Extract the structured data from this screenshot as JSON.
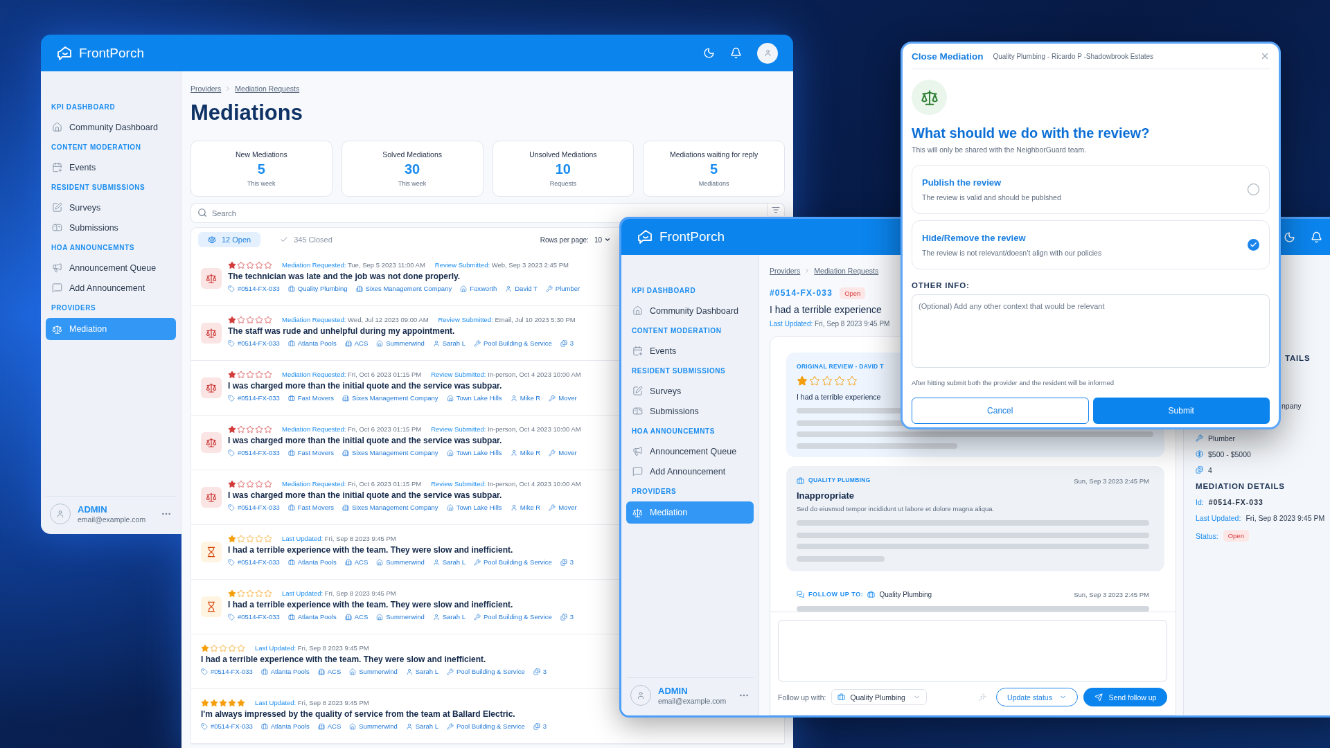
{
  "main_window": {
    "brand": "**Front**Porch",
    "sidebar": {
      "sections": [
        {
          "title": "KPI DASHBOARD",
          "items": [
            {
              "label": "Community Dashboard",
              "selected": false
            }
          ]
        },
        {
          "title": "CONTENT MODERATION",
          "items": [
            {
              "label": "Events",
              "selected": false
            }
          ]
        },
        {
          "title": "RESIDENT SUBMISSIONS",
          "items": [
            {
              "label": "Surveys",
              "selected": false
            },
            {
              "label": "Submissions",
              "selected": false
            }
          ]
        },
        {
          "title": "HOA ANNOUNCEMNTS",
          "items": [
            {
              "label": "Announcement Queue",
              "selected": false
            },
            {
              "label": "Add Announcement",
              "selected": false
            }
          ]
        },
        {
          "title": "PROVIDERS",
          "items": [
            {
              "label": "Mediation",
              "selected": true
            }
          ]
        }
      ],
      "user": {
        "name": "ADMIN",
        "email": "email@example.com"
      }
    },
    "breadcrumbs": [
      "Providers",
      "Mediation Requests"
    ],
    "title": "Mediations",
    "stats": [
      {
        "label": "New Mediations",
        "value": "5",
        "caption": "This week"
      },
      {
        "label": "Solved Mediations",
        "value": "30",
        "caption": "This week"
      },
      {
        "label": "Unsolved Mediations",
        "value": "10",
        "caption": "Requests"
      },
      {
        "label": "Mediations waiting for reply",
        "value": "5",
        "caption": "Mediations"
      }
    ],
    "search": {
      "placeholder": "Search"
    },
    "tabs": [
      {
        "label": "12 Open",
        "selected": true
      },
      {
        "label": "345 Closed",
        "selected": false
      }
    ],
    "rows_per_page": {
      "label": "Rows per page:",
      "value": "10"
    },
    "rows": [
      {
        "kind": "mediation",
        "stars": 1,
        "fields": [
          {
            "label": "Mediation Requested:",
            "value": "Tue, Sep 5 2023 11:00 AM"
          },
          {
            "label": "Review Submitted:",
            "value": "Web, Sep 3 2023 2:45 PM"
          }
        ],
        "text": "The technician was late and the job was not done properly.",
        "meta": [
          "#0514-FX-033",
          "Quality Plumbing",
          "Sixes Management Company",
          "Foxworth",
          "David T",
          "Plumber"
        ]
      },
      {
        "kind": "mediation",
        "stars": 1,
        "fields": [
          {
            "label": "Mediation Requested:",
            "value": "Wed, Jul 12 2023 09:00 AM"
          },
          {
            "label": "Review Submitted:",
            "value": "Email, Jul 10 2023 5:30 PM"
          }
        ],
        "text": "The staff was rude and unhelpful during my appointment.",
        "meta": [
          "#0514-FX-033",
          "Atlanta Pools",
          "ACS",
          "Summerwind",
          "Sarah L",
          "Pool Building & Service",
          "3"
        ]
      },
      {
        "kind": "mediation",
        "stars": 1,
        "fields": [
          {
            "label": "Mediation Requested:",
            "value": "Fri, Oct 6 2023 01:15 PM"
          },
          {
            "label": "Review Submitted:",
            "value": "In-person, Oct 4 2023 10:00 AM"
          }
        ],
        "text": "I was charged more than the initial quote and the service was subpar.",
        "meta": [
          "#0514-FX-033",
          "Fast Movers",
          "Sixes Management Company",
          "Town Lake Hills",
          "Mike R",
          "Mover"
        ]
      },
      {
        "kind": "mediation",
        "stars": 1,
        "fields": [
          {
            "label": "Mediation Requested:",
            "value": "Fri, Oct 6 2023 01:15 PM"
          },
          {
            "label": "Review Submitted:",
            "value": "In-person, Oct 4 2023 10:00 AM"
          }
        ],
        "text": "I was charged more than the initial quote and the service was subpar.",
        "meta": [
          "#0514-FX-033",
          "Fast Movers",
          "Sixes Management Company",
          "Town Lake Hills",
          "Mike R",
          "Mover"
        ]
      },
      {
        "kind": "mediation",
        "stars": 1,
        "fields": [
          {
            "label": "Mediation Requested:",
            "value": "Fri, Oct 6 2023 01:15 PM"
          },
          {
            "label": "Review Submitted:",
            "value": "In-person, Oct 4 2023 10:00 AM"
          }
        ],
        "text": "I was charged more than the initial quote and the service was subpar.",
        "meta": [
          "#0514-FX-033",
          "Fast Movers",
          "Sixes Management Company",
          "Town Lake Hills",
          "Mike R",
          "Mover"
        ]
      },
      {
        "kind": "pending",
        "stars": 1,
        "fields": [
          {
            "label": "Last Updated:",
            "value": "Fri, Sep 8 2023 9:45 PM"
          }
        ],
        "text": "I had a terrible experience with the team. They were slow and inefficient.",
        "meta": [
          "#0514-FX-033",
          "Atlanta Pools",
          "ACS",
          "Summerwind",
          "Sarah L",
          "Pool Building & Service",
          "3"
        ]
      },
      {
        "kind": "pending",
        "stars": 1,
        "fields": [
          {
            "label": "Last Updated:",
            "value": "Fri, Sep 8 2023 9:45 PM"
          }
        ],
        "text": "I had a terrible experience with the team. They were slow and inefficient.",
        "meta": [
          "#0514-FX-033",
          "Atlanta Pools",
          "ACS",
          "Summerwind",
          "Sarah L",
          "Pool Building & Service",
          "3"
        ]
      },
      {
        "kind": "plain",
        "stars": 1,
        "fields": [
          {
            "label": "Last Updated:",
            "value": "Fri, Sep 8 2023 9:45 PM"
          }
        ],
        "text": "I had a terrible experience with the team. They were slow and inefficient.",
        "meta": [
          "#0514-FX-033",
          "Atlanta Pools",
          "ACS",
          "Summerwind",
          "Sarah L",
          "Pool Building & Service",
          "3"
        ]
      },
      {
        "kind": "plain",
        "stars": 5,
        "fields": [
          {
            "label": "Last Updated:",
            "value": "Fri, Sep 8 2023 9:45 PM"
          }
        ],
        "text": "I'm always impressed by the quality of service from the team at Ballard Electric.",
        "meta": [
          "#0514-FX-033",
          "Atlanta Pools",
          "ACS",
          "Summerwind",
          "Sarah L",
          "Pool Building & Service",
          "3"
        ]
      }
    ]
  },
  "detail_window": {
    "brand": "**Front**Porch",
    "sidebar": {
      "sections": [
        {
          "title": "KPI DASHBOARD",
          "items": [
            {
              "label": "Community Dashboard",
              "selected": false
            }
          ]
        },
        {
          "title": "CONTENT MODERATION",
          "items": [
            {
              "label": "Events",
              "selected": false
            }
          ]
        },
        {
          "title": "RESIDENT SUBMISSIONS",
          "items": [
            {
              "label": "Surveys",
              "selected": false
            },
            {
              "label": "Submissions",
              "selected": false
            }
          ]
        },
        {
          "title": "HOA ANNOUNCEMNTS",
          "items": [
            {
              "label": "Announcement Queue",
              "selected": false
            },
            {
              "label": "Add Announcement",
              "selected": false
            }
          ]
        },
        {
          "title": "PROVIDERS",
          "items": [
            {
              "label": "Mediation",
              "selected": true
            }
          ]
        }
      ],
      "user": {
        "name": "ADMIN",
        "email": "email@example.com"
      }
    },
    "breadcrumbs": [
      "Providers",
      "Mediation Requests"
    ],
    "id": "#0514-FX-033",
    "status": "Open",
    "title": "I had a terrible experience",
    "updated": {
      "label": "Last Updated:",
      "value": "Fri, Sep 8 2023 9:45 PM"
    },
    "original_review": {
      "heading": "ORIGINAL REVIEW - DAVID T",
      "stars": 1,
      "title": "I had a terrible experience"
    },
    "response": {
      "provider": "QUALITY PLUMBING",
      "date": "Sun, Sep 3 2023 2:45 PM",
      "title": "Inappropriate",
      "body": "Sed do eiusmod tempor incididunt ut labore et dolore magna aliqua."
    },
    "follow_up": {
      "label": "FOLLOW UP TO:",
      "provider": "Quality Plumbing",
      "date": "Sun, Sep 3 2023 2:45 PM"
    },
    "composer": {
      "label": "Follow up with:",
      "provider": "Quality Plumbing",
      "status_button": "Update status",
      "send_button": "Send follow up"
    },
    "details": {
      "heading_fragment": "TAILS",
      "text_fragment": "npany",
      "items": [
        "Plumber",
        "$500 - $5000",
        "4"
      ],
      "mediation": {
        "heading": "MEDIATION DETAILS",
        "id_label": "Id:",
        "id": "#0514-FX-033",
        "updated_label": "Last Updated:",
        "updated": "Fri, Sep 8 2023 9:45 PM",
        "status_label": "Status:",
        "status": "Open"
      }
    }
  },
  "modal": {
    "title": "Close Mediation",
    "subtitle": "Quality Plumbing - Ricardo P -Shadowbrook Estates",
    "heading": "What should we do with the review?",
    "description": "This will only be shared with the NeighborGuard team.",
    "options": [
      {
        "title": "Publish the review",
        "description": "The review is valid and should be publshed",
        "selected": false
      },
      {
        "title": "Hide/Remove the review",
        "description": "The review is not relevant/doesn’t align with our policies",
        "selected": true
      }
    ],
    "other_info": {
      "label": "OTHER INFO:",
      "placeholder": "(Optional) Add any other context that would be relevant"
    },
    "note": "After hitting submit both the provider and the resident will be informed",
    "buttons": [
      {
        "kind": "secondary",
        "label": "Cancel"
      },
      {
        "kind": "primary",
        "label": "Submit"
      }
    ]
  }
}
